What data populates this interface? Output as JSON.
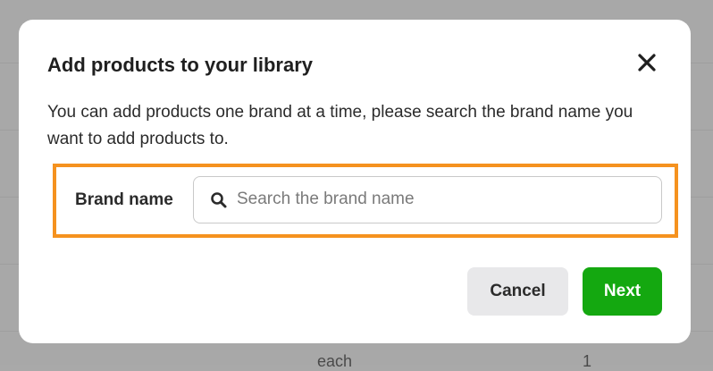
{
  "background": {
    "text_unit": "each",
    "text_qty": "1"
  },
  "modal": {
    "title": "Add products to your library",
    "close_icon": "close-icon",
    "description": "You can add products one brand at a time, please search the brand name you want to add products to.",
    "brand_field": {
      "label": "Brand name",
      "value": "",
      "placeholder": "Search the brand name",
      "icon": "search-icon"
    },
    "buttons": {
      "cancel_label": "Cancel",
      "next_label": "Next"
    }
  },
  "colors": {
    "highlight": "#f5921f",
    "primary": "#14a810",
    "secondary_button": "#e8e8ea",
    "overlay": "#a8a8a8"
  }
}
